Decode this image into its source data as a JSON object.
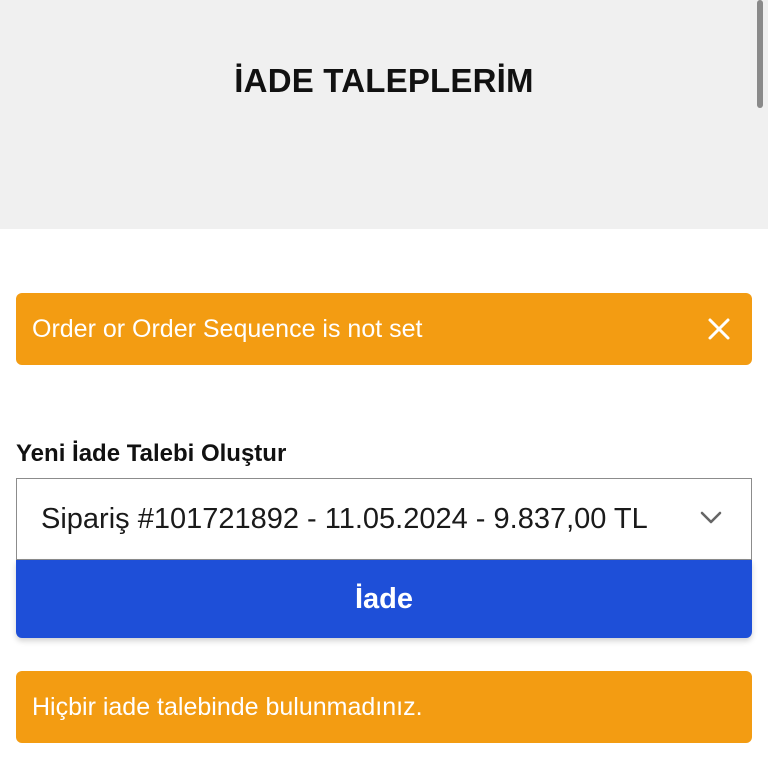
{
  "header": {
    "title": "İADE TALEPLERİM"
  },
  "alert_top": {
    "message": "Order or Order Sequence is not set",
    "close_icon": "close-icon"
  },
  "form": {
    "section_label": "Yeni İade Talebi Oluştur",
    "order_select": {
      "selected_value": "Sipariş #101721892 - 11.05.2024 - 9.837,00 TL"
    },
    "submit_label": "İade"
  },
  "alert_bottom": {
    "message": "Hiçbir iade talebinde bulunmadınız."
  },
  "colors": {
    "header_bg": "#f0f0f0",
    "alert": "#f39c12",
    "primary": "#1e4fd8"
  }
}
